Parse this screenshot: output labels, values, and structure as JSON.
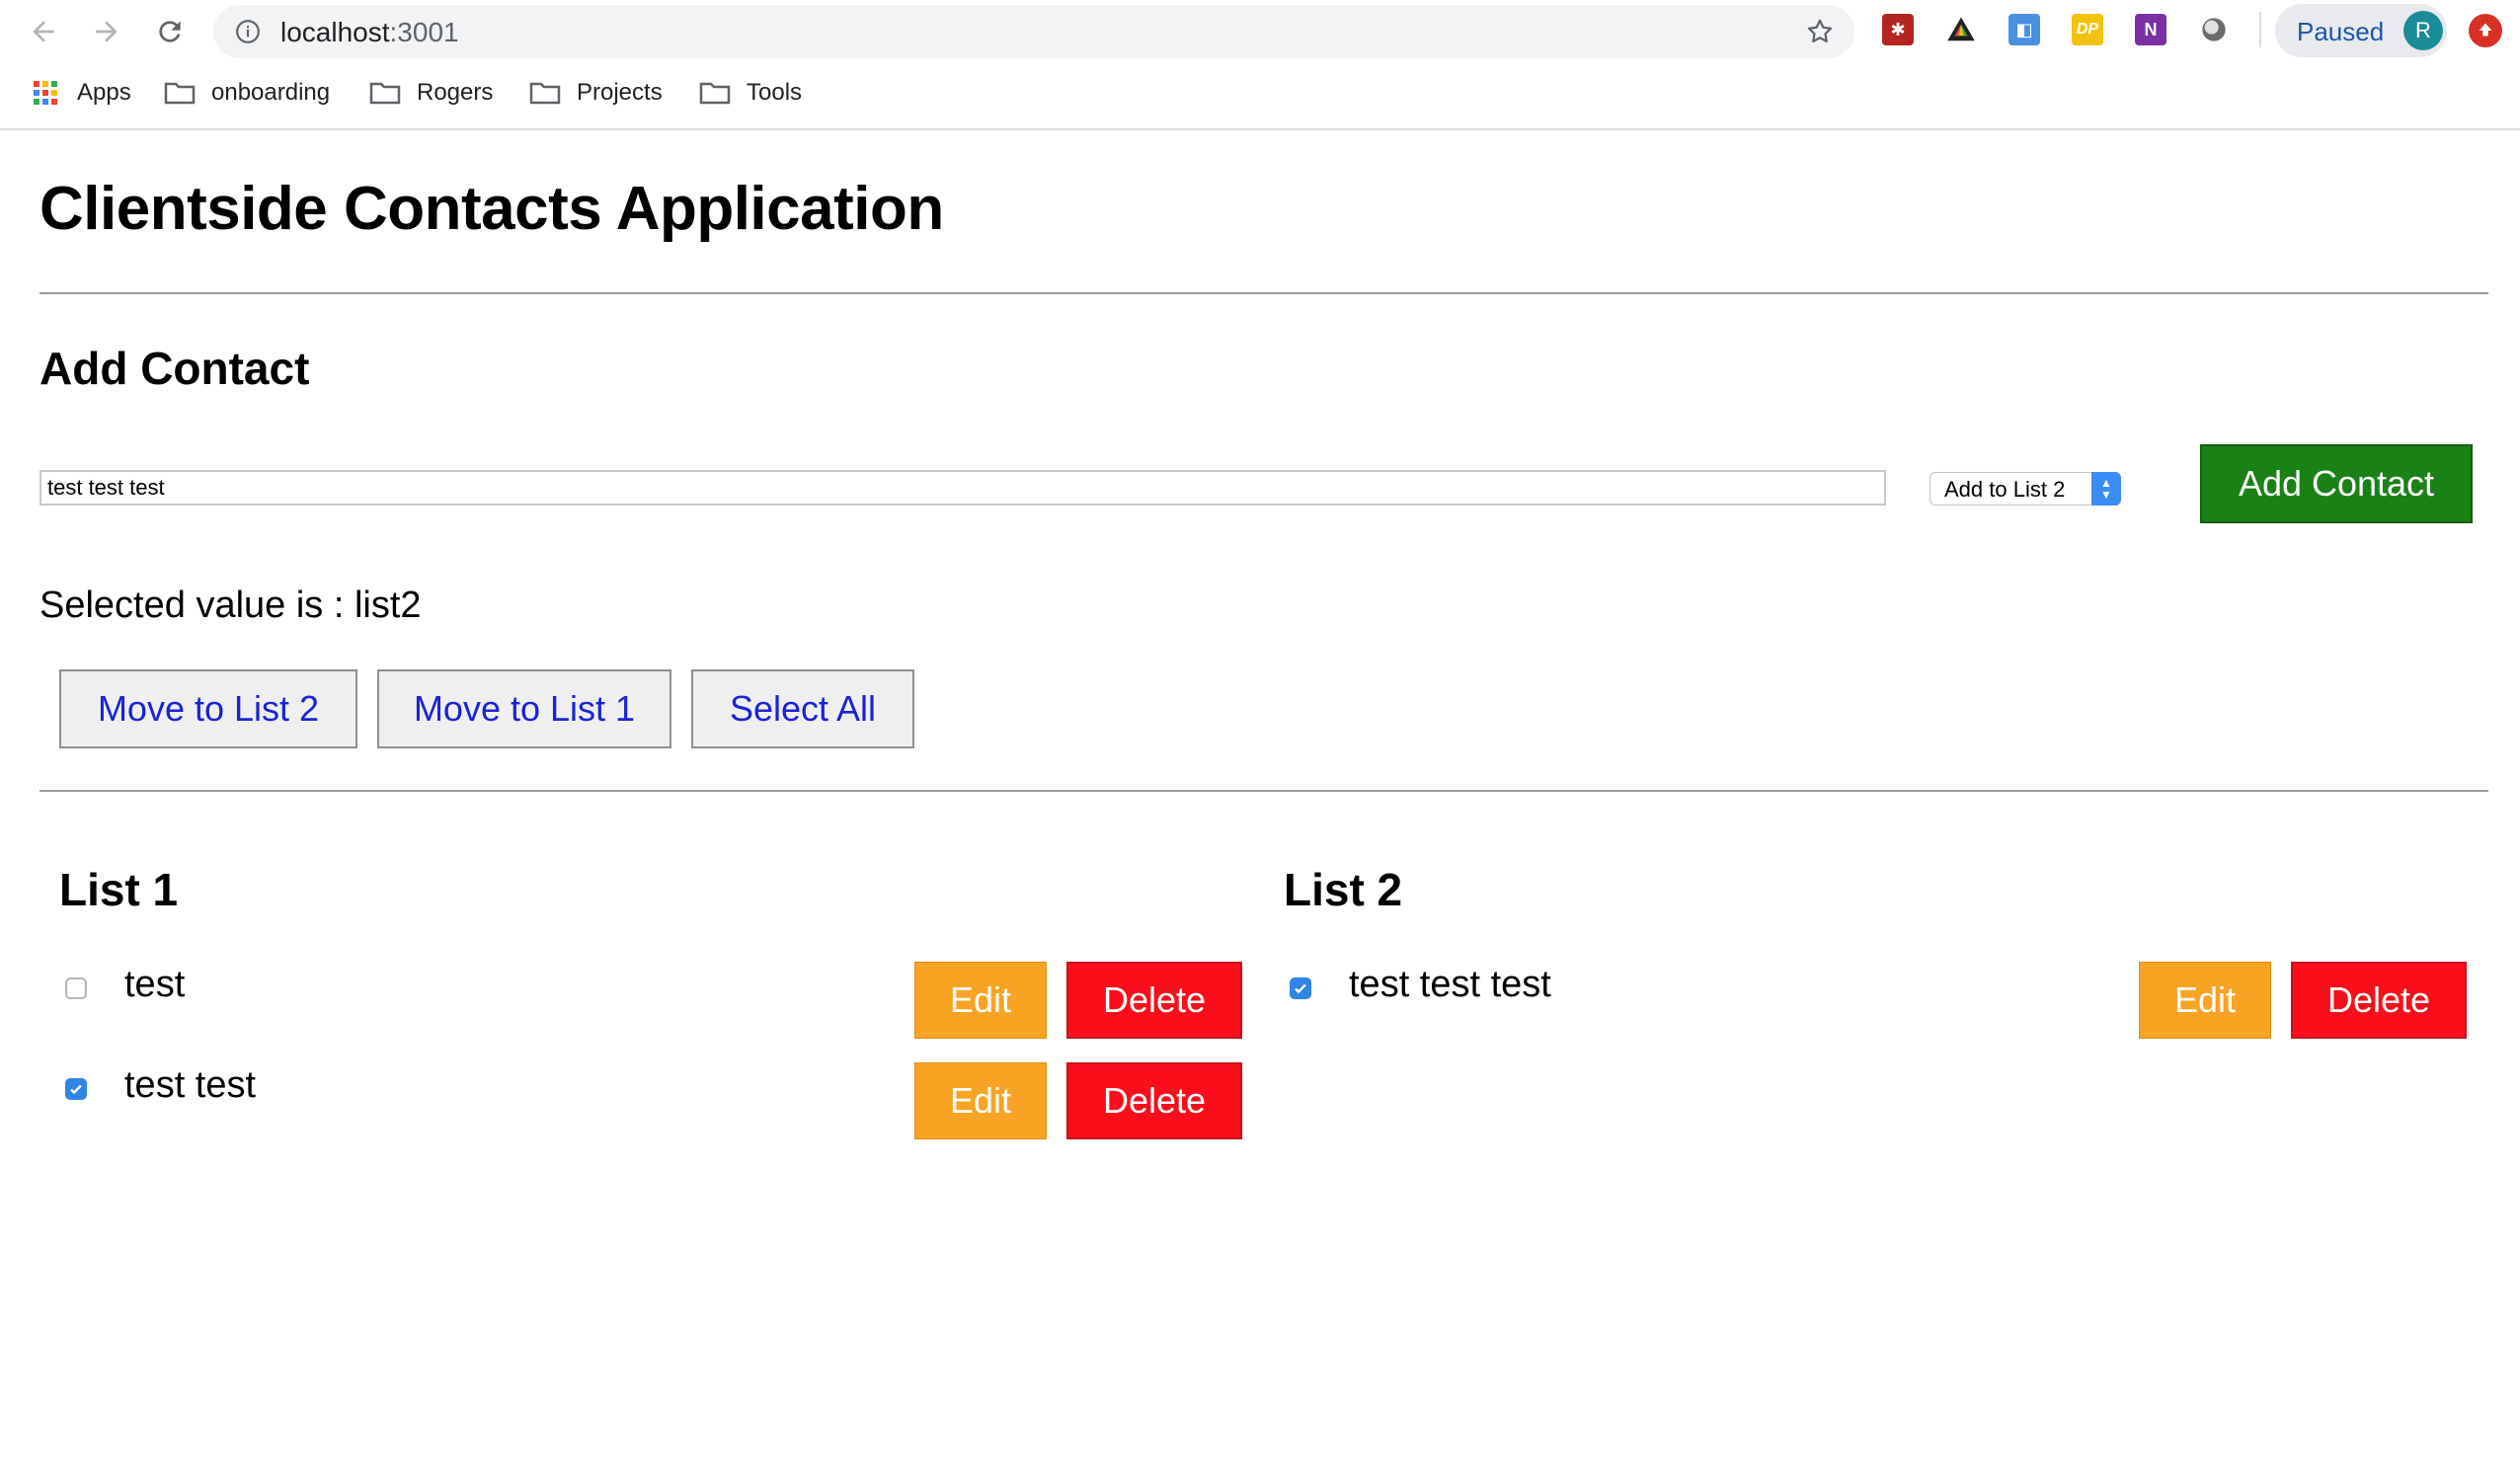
{
  "browser": {
    "url_host": "localhost",
    "url_port": ":3001",
    "profile_label": "Paused",
    "profile_initial": "R",
    "extensions": [
      {
        "name": "red-extension-icon",
        "color": "#b3261e",
        "text": "✱"
      },
      {
        "name": "drive-extension-icon",
        "color": "#202124",
        "text": "▲"
      },
      {
        "name": "blue-extension-icon",
        "color": "#4a90e2",
        "text": "◧"
      },
      {
        "name": "dp-extension-icon",
        "color": "#f4c20d",
        "text": "DP"
      },
      {
        "name": "onenote-extension-icon",
        "color": "#7b2fa3",
        "text": "N"
      },
      {
        "name": "grey-extension-icon",
        "color": "#6b6b6b",
        "text": "●"
      }
    ],
    "bookmarks": {
      "apps": "Apps",
      "onboarding": "onboarding",
      "rogers": "Rogers",
      "projects": "Projects",
      "tools": "Tools"
    }
  },
  "page": {
    "title": "Clientside Contacts Application",
    "add_heading": "Add Contact",
    "input_value": "test test test",
    "select_value": "Add to List 2",
    "add_button": "Add Contact",
    "selected_text": "Selected value is : list2",
    "move_to_list2": "Move to List 2",
    "move_to_list1": "Move to List 1",
    "select_all": "Select All",
    "edit_label": "Edit",
    "delete_label": "Delete"
  },
  "list1": {
    "title": "List 1",
    "items": [
      {
        "label": "test",
        "checked": false
      },
      {
        "label": "test test",
        "checked": true
      }
    ]
  },
  "list2": {
    "title": "List 2",
    "items": [
      {
        "label": "test test test",
        "checked": true
      }
    ]
  },
  "colors": {
    "add_button": "#1a8116",
    "edit_button": "#f8a324",
    "delete_button": "#fa0e1c",
    "link_text": "#1a23d6",
    "checkbox": "#2f86e6"
  }
}
